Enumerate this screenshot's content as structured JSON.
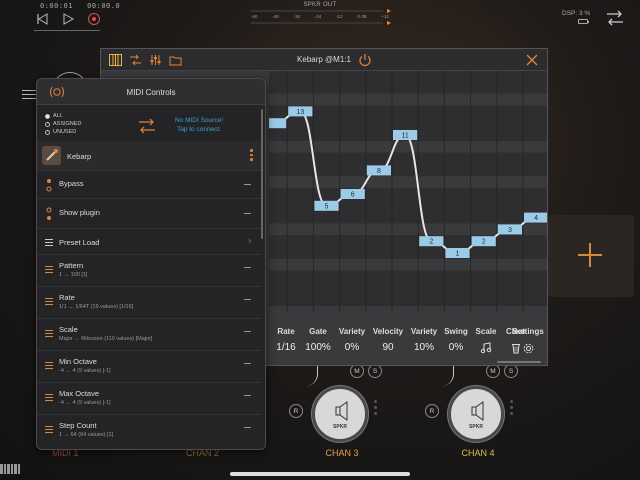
{
  "transport": {
    "time_left": "0:00:01",
    "time_right": "00:00.0"
  },
  "spkr_out": {
    "title": "SPKR OUT",
    "scale": [
      "-60",
      "-48",
      "-36",
      "-24",
      "-12",
      "0 dB",
      "+12"
    ]
  },
  "status": {
    "dsp": "DSP: 3 %"
  },
  "plugin_window": {
    "title": "Kebarp @M1:1",
    "steps": [
      {
        "label": "",
        "value": 12
      },
      {
        "label": "13",
        "value": 13
      },
      {
        "label": "5",
        "value": 5
      },
      {
        "label": "6",
        "value": 6
      },
      {
        "label": "8",
        "value": 8
      },
      {
        "label": "11",
        "value": 11
      },
      {
        "label": "2",
        "value": 2
      },
      {
        "label": "1",
        "value": 1
      },
      {
        "label": "2",
        "value": 2
      },
      {
        "label": "3",
        "value": 3
      },
      {
        "label": "4",
        "value": 4
      }
    ],
    "controls": [
      {
        "label": "Rate",
        "value": "1/16"
      },
      {
        "label": "Gate",
        "value": "100%"
      },
      {
        "label": "Variety",
        "value": "0%"
      },
      {
        "label": "Velocity",
        "value": "90"
      },
      {
        "label": "Variety",
        "value": "10%"
      },
      {
        "label": "Swing",
        "value": "0%"
      },
      {
        "label": "Scale",
        "value": ""
      },
      {
        "label": "Clear",
        "value": ""
      },
      {
        "label": "Settings",
        "value": ""
      }
    ]
  },
  "midi_panel": {
    "title": "MIDI Controls",
    "filters": [
      {
        "label": "ALL",
        "selected": true
      },
      {
        "label": "ASSIGNED",
        "selected": false
      },
      {
        "label": "UNUSED",
        "selected": false
      }
    ],
    "source_line1": "No MIDI Source!",
    "source_line2": "Tap to connect.",
    "plugin_name": "Kebarp",
    "rows": [
      {
        "name": "Bypass",
        "sub": "",
        "icon": "toggle",
        "trail": "dash"
      },
      {
        "name": "Show plugin",
        "sub": "",
        "icon": "toggle",
        "trail": "dash"
      },
      {
        "name": "Preset Load",
        "sub": "",
        "icon": "list",
        "trail": "chevron"
      },
      {
        "name": "Pattern",
        "sub": "1 → 100 [1]",
        "icon": "slider",
        "trail": "dash"
      },
      {
        "name": "Rate",
        "sub": "1/1 → 1/64T (19 values) [1/16]",
        "icon": "slider",
        "trail": "dash"
      },
      {
        "name": "Scale",
        "sub": "Major → Ritsusen (110 values) [Major]",
        "icon": "slider",
        "trail": "dash"
      },
      {
        "name": "Min Octave",
        "sub": "-4 → 4 (9 values) [-1]",
        "icon": "slider",
        "trail": "dash"
      },
      {
        "name": "Max Octave",
        "sub": "-4 → 4 (9 values) [-1]",
        "icon": "slider",
        "trail": "dash"
      },
      {
        "name": "Step Count",
        "sub": "1 → 64 (64 values) [1]",
        "icon": "slider",
        "trail": "dash"
      }
    ]
  },
  "channels": [
    {
      "name": "MIDI 1",
      "color": "#9b4a3a"
    },
    {
      "name": "CHAN 2",
      "color": "#9b6a3a"
    },
    {
      "name": "CHAN 3",
      "color": "#e0a04a",
      "node_label": "SPKR"
    },
    {
      "name": "CHAN 4",
      "color": "#d6c04a",
      "node_label": "SPKR"
    }
  ],
  "buttons": {
    "mute": "M",
    "solo": "S",
    "record": "R"
  },
  "colors": {
    "accent": "#e0853a",
    "step_fill": "#9ccbe8",
    "link_blue": "#3aa0d8"
  }
}
